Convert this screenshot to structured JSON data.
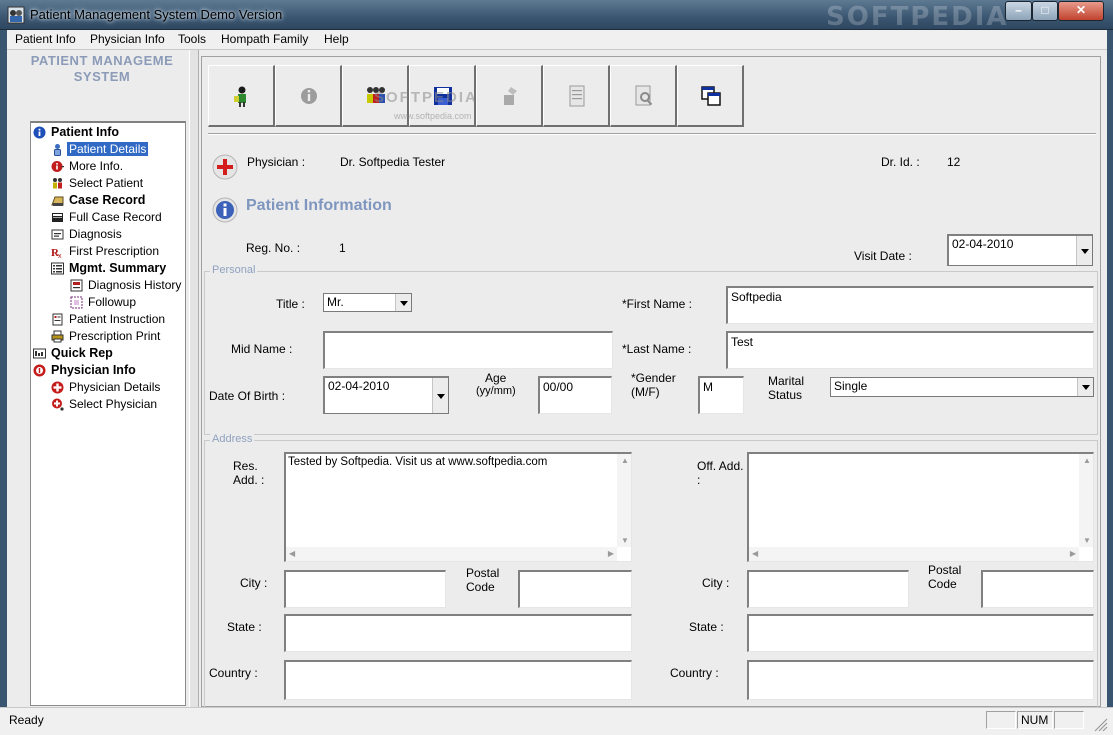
{
  "window": {
    "title": "Patient Management System Demo Version",
    "watermark": "SOFTPEDIA",
    "buttons": {
      "minimize": "–",
      "maximize": "□",
      "close": "✕"
    }
  },
  "menu": [
    "Patient Info",
    "Physician Info",
    "Tools",
    "Hompath Family",
    "Help"
  ],
  "sidebar": {
    "header_line1": "PATIENT MANAGEME",
    "header_line2": "SYSTEM",
    "items": [
      {
        "label": "Patient Info",
        "bold": true,
        "icon": "info-icon"
      },
      {
        "label": "Patient Details",
        "selected": true,
        "icon": "person-icon"
      },
      {
        "label": "More Info.",
        "icon": "info-small-icon"
      },
      {
        "label": "Select Patient",
        "icon": "people-icon"
      },
      {
        "label": "Case Record",
        "bold": true,
        "icon": "case-icon"
      },
      {
        "label": "Full Case Record",
        "icon": "book-icon"
      },
      {
        "label": "Diagnosis",
        "icon": "diagnosis-icon"
      },
      {
        "label": "First Prescription",
        "icon": "rx-icon"
      },
      {
        "label": "Mgmt. Summary",
        "bold": true,
        "icon": "list-icon"
      },
      {
        "label": "Diagnosis History",
        "icon": "history-icon"
      },
      {
        "label": "Followup",
        "icon": "followup-icon"
      },
      {
        "label": "Patient Instruction",
        "icon": "instruction-icon"
      },
      {
        "label": "Prescription Print",
        "icon": "printer-icon"
      },
      {
        "label": "Quick Rep",
        "bold": true,
        "icon": "report-icon"
      },
      {
        "label": "Physician Info",
        "bold": true,
        "icon": "physician-info-icon"
      },
      {
        "label": "Physician Details",
        "icon": "red-cross-icon"
      },
      {
        "label": "Select Physician",
        "icon": "select-physician-icon"
      }
    ]
  },
  "toolbar": {
    "watermark": "SOFTPEDIA",
    "watermark_sub": "www.softpedia.com",
    "buttons": [
      "new-patient-icon",
      "info-icon",
      "select-icon",
      "save-icon",
      "delete-icon",
      "document-icon",
      "preview-icon",
      "copy-icon"
    ]
  },
  "physician": {
    "label": "Physician :",
    "name": "Dr. Softpedia Tester",
    "id_label": "Dr. Id. :",
    "id": "12"
  },
  "heading": "Patient Information",
  "reg": {
    "label": "Reg. No.   :",
    "value": "1"
  },
  "visit": {
    "label": "Visit Date :",
    "value": "02-04-2010"
  },
  "personal": {
    "group": "Personal",
    "title_label": "Title :",
    "title_value": "Mr.",
    "first_label": "*First Name :",
    "first_value": "Softpedia",
    "mid_label": "Mid Name :",
    "mid_value": "",
    "last_label": "*Last Name :",
    "last_value": "Test",
    "dob_label": "Date Of Birth :",
    "dob_value": "02-04-2010",
    "age_label": "Age",
    "age_unit": "(yy/mm)",
    "age_value": "00/00",
    "gender_label": "*Gender",
    "gender_unit": "(M/F)",
    "gender_value": "M",
    "marital_label1": "Marital",
    "marital_label2": "Status",
    "marital_value": "Single"
  },
  "address": {
    "group": "Address",
    "res_label1": "Res.",
    "res_label2": "Add. :",
    "res_value": "Tested by Softpedia. Visit us at www.softpedia.com",
    "off_label1": "Off. Add.",
    "off_label2": ":",
    "off_value": "",
    "city_label": "City :",
    "postal_label1": "Postal",
    "postal_label2": "Code",
    "state_label": "State :",
    "country_label": "Country :"
  },
  "status": {
    "text": "Ready",
    "num": "NUM"
  }
}
